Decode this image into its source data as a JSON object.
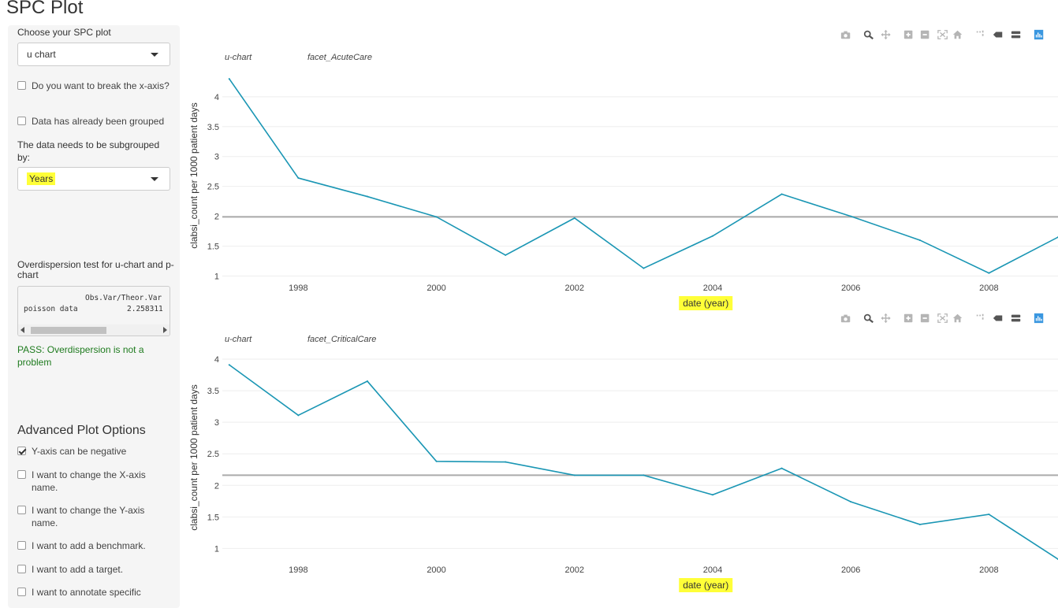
{
  "page_title": "SPC Plot",
  "sidebar": {
    "plot_select_label": "Choose your SPC plot",
    "plot_select_value": "u chart",
    "break_x_axis_label": "Do you want to break the x-axis?",
    "already_grouped_label": "Data has already been grouped",
    "subgroup_label": "The data needs to be subgrouped by:",
    "subgroup_value": "Years",
    "overdispersion_title": "Overdispersion test for u-chart and p-chart",
    "overdispersion_output": {
      "header": "Obs.Var/Theor.Var",
      "row_label": "poisson data",
      "row_value": "2.258311"
    },
    "pass_message": "PASS: Overdispersion is not a problem",
    "advanced_title": "Advanced Plot Options",
    "options": [
      {
        "label": "Y-axis can be negative",
        "checked": true
      },
      {
        "label": "I want to change the X-axis name.",
        "checked": false
      },
      {
        "label": "I want to change the Y-axis name.",
        "checked": false
      },
      {
        "label": "I want to add a benchmark.",
        "checked": false
      },
      {
        "label": "I want to add a target.",
        "checked": false
      },
      {
        "label": "I want to annotate specific",
        "checked": false
      }
    ]
  },
  "modebar": {
    "icons": [
      "camera-icon",
      "zoom-icon",
      "pan-icon",
      "zoom-in-icon",
      "zoom-out-icon",
      "autoscale-icon",
      "reset-axes-icon",
      "spike-lines-icon",
      "hover-closest-icon",
      "hover-compare-icon",
      "plotly-logo-icon"
    ]
  },
  "colors": {
    "line": "#1a96b4",
    "center_line": "#aaaaaa",
    "highlight": "#ffff38",
    "pass": "#1e7b1e"
  },
  "chart_data": [
    {
      "type": "line",
      "chart_label": "u-chart",
      "facet_label": "facet_AcuteCare",
      "xlabel": "date (year)",
      "ylabel": "clabsi_count per 1000 patient days",
      "x": [
        1997,
        1998,
        1999,
        2000,
        2001,
        2002,
        2003,
        2004,
        2005,
        2006,
        2007,
        2008,
        2009
      ],
      "series": [
        {
          "values": [
            4.3,
            2.64,
            2.33,
            1.99,
            1.35,
            1.97,
            1.13,
            1.67,
            2.37,
            2.0,
            1.6,
            1.05,
            1.65
          ]
        }
      ],
      "center_line": 1.99,
      "xticks": [
        "1998",
        "2000",
        "2002",
        "2004",
        "2006",
        "2008"
      ],
      "yticks": [
        "1",
        "1.5",
        "2",
        "2.5",
        "3",
        "3.5",
        "4"
      ],
      "xlim": [
        1996.9,
        2009.0
      ],
      "ylim": [
        0.98,
        4.38
      ],
      "grid": true
    },
    {
      "type": "line",
      "chart_label": "u-chart",
      "facet_label": "facet_CriticalCare",
      "xlabel": "date (year)",
      "ylabel": "clabsi_count per 1000 patient days",
      "x": [
        1997,
        1998,
        1999,
        2000,
        2001,
        2002,
        2003,
        2004,
        2005,
        2006,
        2007,
        2008,
        2009
      ],
      "series": [
        {
          "values": [
            3.91,
            3.11,
            3.65,
            2.38,
            2.37,
            2.16,
            2.16,
            1.85,
            2.27,
            1.74,
            1.38,
            1.54,
            0.83
          ]
        }
      ],
      "center_line": 2.16,
      "xticks": [
        "1998",
        "2000",
        "2002",
        "2004",
        "2006",
        "2008"
      ],
      "yticks": [
        "1",
        "1.5",
        "2",
        "2.5",
        "3",
        "3.5",
        "4"
      ],
      "xlim": [
        1996.9,
        2009.0
      ],
      "ylim": [
        0.83,
        4.05
      ],
      "grid": true
    }
  ]
}
